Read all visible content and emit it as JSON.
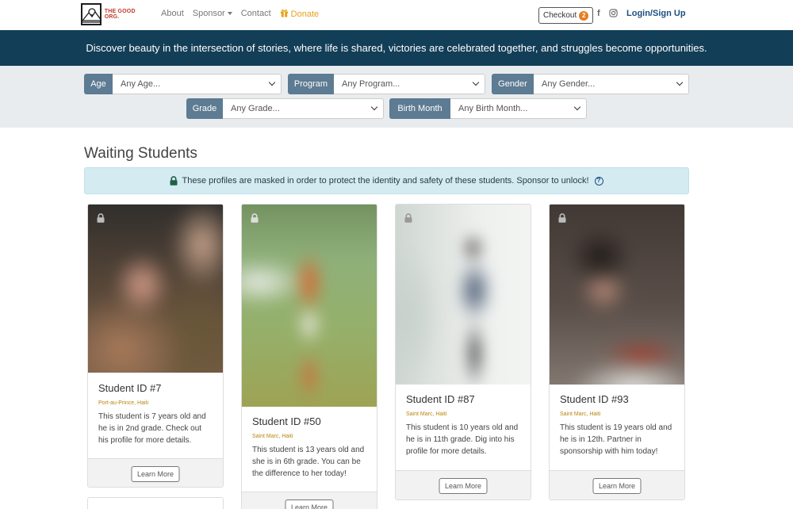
{
  "nav": {
    "logo_text": "THE GOOD ORG.",
    "links": [
      "About",
      "Sponsor",
      "Contact"
    ],
    "donate": "Donate",
    "checkout": "Checkout",
    "checkout_count": "2",
    "facebook_glyph": "f",
    "instagram_glyph": "◎",
    "login": "Login/Sign Up"
  },
  "banner": {
    "text": "Discover beauty in the intersection of stories, where life is shared, victories are celebrated together, and struggles become opportunities."
  },
  "filters": {
    "age": {
      "label": "Age",
      "value": "Any Age..."
    },
    "program": {
      "label": "Program",
      "value": "Any Program..."
    },
    "gender": {
      "label": "Gender",
      "value": "Any Gender..."
    },
    "grade": {
      "label": "Grade",
      "value": "Any Grade..."
    },
    "birth_month": {
      "label": "Birth Month",
      "value": "Any Birth Month..."
    }
  },
  "main": {
    "title": "Waiting Students",
    "alert": "These profiles are masked in order to protect the identity and safety of these students. Sponsor to unlock!",
    "help_glyph": "?"
  },
  "students": [
    {
      "title": "Student ID #7",
      "location": "Port-au-Prince, Haiti",
      "description": "This student is 7 years old and he is in 2nd grade. Check out his profile for more details.",
      "button": "Learn More"
    },
    {
      "title": "Student ID #50",
      "location": "Saint Marc, Haiti",
      "description": "This student is 13 years old and she is in 6th grade. You can be the difference to her today!",
      "button": "Learn More"
    },
    {
      "title": "Student ID #87",
      "location": "Saint Marc, Haiti",
      "description": "This student is 10 years old and he is in 11th grade. Dig into his profile for more details.",
      "button": "Learn More"
    },
    {
      "title": "Student ID #93",
      "location": "Saint Marc, Haiti",
      "description": "This student is 19 years old and he is in 12th. Partner in sponsorship with him today!",
      "button": "Learn More"
    }
  ],
  "colors": {
    "banner": "#133e57",
    "filter_label": "#5d7b92",
    "donate": "#e6a21a",
    "badge": "#e67e22",
    "location": "#b8860b"
  }
}
